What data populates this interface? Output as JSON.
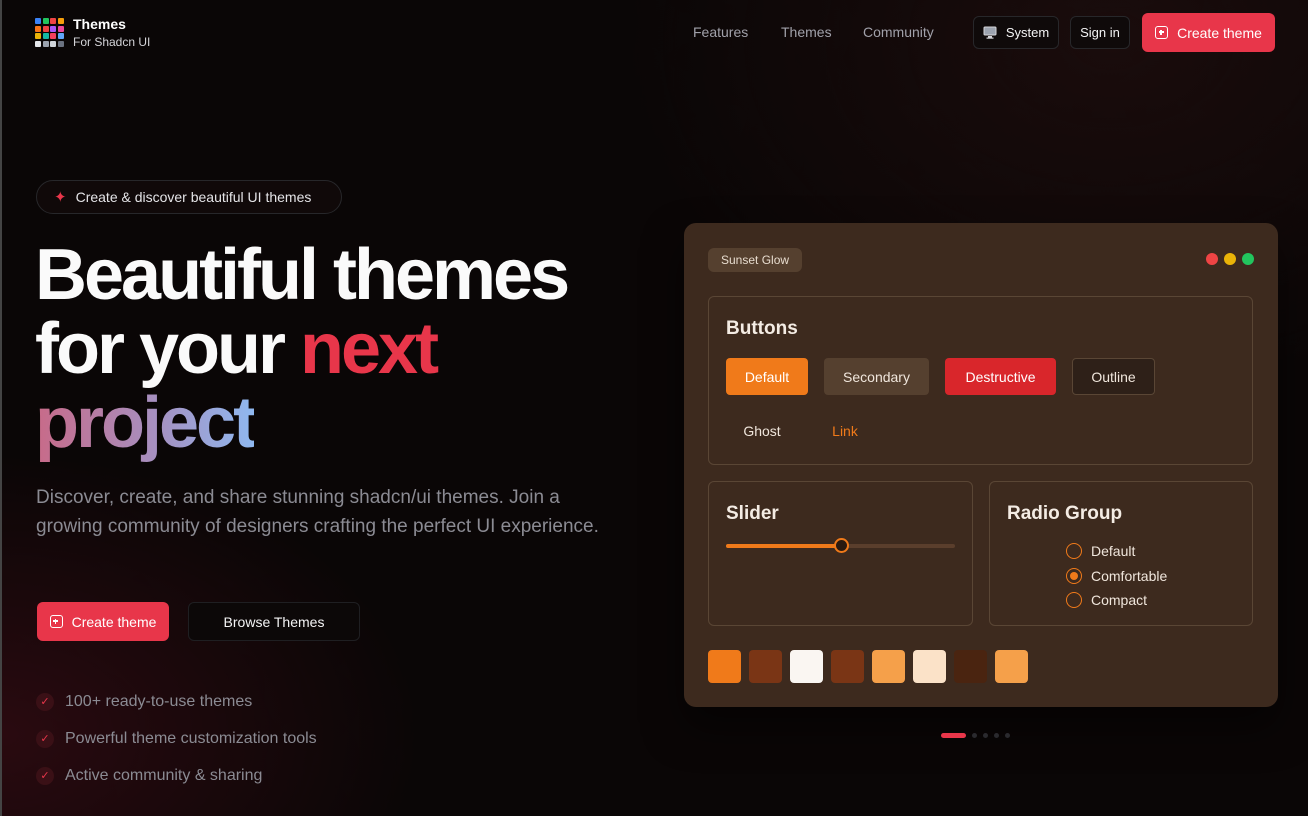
{
  "brand": {
    "title": "Themes",
    "subtitle": "For Shadcn UI",
    "logo_colors": [
      "#3b82f6",
      "#22c55e",
      "#ef4444",
      "#f59e0b",
      "#f97316",
      "#ef4444",
      "#a855f7",
      "#ec4899",
      "#eab308",
      "#14b8a6",
      "#f43f5e",
      "#60a5fa",
      "#e5e7eb",
      "#9ca3af",
      "#d1d5db",
      "#6b7280"
    ]
  },
  "nav": {
    "links": [
      "Features",
      "Themes",
      "Community"
    ],
    "system_label": "System",
    "system_icon": "monitor-icon",
    "signin_label": "Sign in",
    "create_label": "Create theme"
  },
  "hero": {
    "pill_text": "Create & discover beautiful UI themes",
    "pill_icon": "sparkles-icon",
    "headline_line1": "Beautiful themes",
    "headline_line2_a": "for your ",
    "headline_line2_b": "next",
    "headline_line3": "project",
    "description": "Discover, create, and share stunning shadcn/ui themes. Join a growing community of designers crafting the perfect UI experience.",
    "cta_primary": "Create theme",
    "cta_secondary": "Browse Themes",
    "features": [
      "100+ ready-to-use themes",
      "Powerful theme customization tools",
      "Active community & sharing"
    ]
  },
  "preview": {
    "theme_name": "Sunset Glow",
    "window_dots": [
      "#ef4444",
      "#eab308",
      "#22c55e"
    ],
    "buttons_title": "Buttons",
    "buttons": {
      "default": "Default",
      "secondary": "Secondary",
      "destructive": "Destructive",
      "outline": "Outline",
      "ghost": "Ghost",
      "link": "Link"
    },
    "slider_title": "Slider",
    "slider_value": 0.5,
    "radio_title": "Radio Group",
    "radio_options": [
      "Default",
      "Comfortable",
      "Compact"
    ],
    "radio_selected": "Comfortable",
    "swatches": [
      "#f07a1a",
      "#7a3515",
      "#faf6f2",
      "#7a3515",
      "#f5a04a",
      "#fbe2c8",
      "#4a2410",
      "#f5a04a"
    ]
  },
  "carousel": {
    "count": 5,
    "active": 0
  },
  "colors": {
    "accent": "#e8364a",
    "preview_primary": "#f07a1a"
  }
}
